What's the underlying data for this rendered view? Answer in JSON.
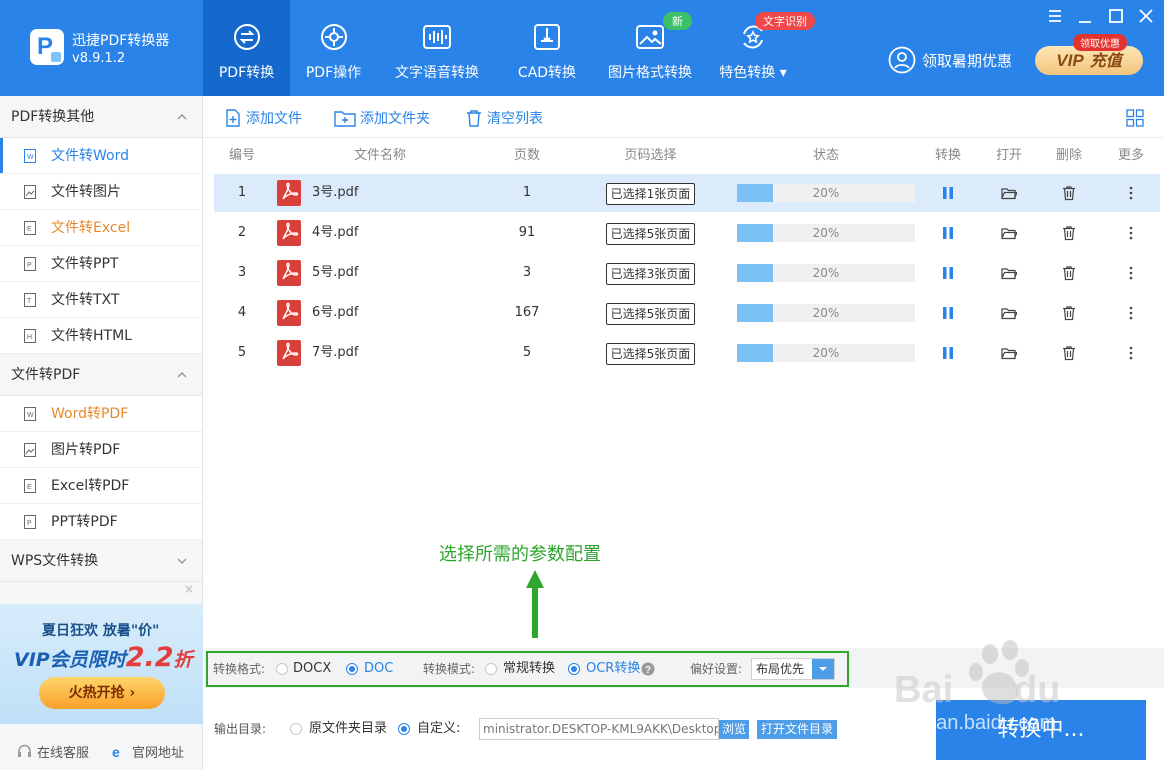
{
  "header": {
    "app_name": "迅捷PDF转换器",
    "version": "v8.9.1.2",
    "promo_text": "领取暑期优惠",
    "vip_tag": "领取优惠",
    "vip_label": "VIP",
    "vip_action": "充值",
    "nav": [
      {
        "label": "PDF转换",
        "icon": "pdf-convert-icon",
        "active": true
      },
      {
        "label": "PDF操作",
        "icon": "gear-icon"
      },
      {
        "label": "文字语音转换",
        "icon": "waveform-icon"
      },
      {
        "label": "CAD转换",
        "icon": "cad-icon"
      },
      {
        "label": "图片格式转换",
        "icon": "image-icon",
        "badge": "新"
      },
      {
        "label": "特色转换",
        "icon": "star-refresh-icon",
        "badge": "文字识别",
        "dropdown": true
      }
    ]
  },
  "sidebar": {
    "groups": [
      {
        "title": "PDF转换其他",
        "expanded": true,
        "items": [
          "文件转Word",
          "文件转图片",
          "文件转Excel",
          "文件转PPT",
          "文件转TXT",
          "文件转HTML"
        ]
      },
      {
        "title": "文件转PDF",
        "expanded": true,
        "items": [
          "Word转PDF",
          "图片转PDF",
          "Excel转PDF",
          "PPT转PDF"
        ]
      },
      {
        "title": "WPS文件转换",
        "expanded": false,
        "items": []
      }
    ],
    "banner": {
      "close": "×",
      "line1": "夏日狂欢 放暑\"价\"",
      "line2": "VIP会员限时",
      "price": "2.2",
      "unit": "折",
      "button": "火热开抢 ›"
    },
    "footer": {
      "service": "在线客服",
      "website": "官网地址"
    }
  },
  "toolbar": {
    "add_file": "添加文件",
    "add_folder": "添加文件夹",
    "clear_list": "清空列表"
  },
  "table": {
    "headers": [
      "编号",
      "文件名称",
      "页数",
      "页码选择",
      "状态",
      "转换",
      "打开",
      "删除",
      "更多"
    ],
    "rows": [
      {
        "no": "1",
        "name": "3号.pdf",
        "pages": "1",
        "selection": "已选择1张页面",
        "progress": 20,
        "status": "20%"
      },
      {
        "no": "2",
        "name": "4号.pdf",
        "pages": "91",
        "selection": "已选择5张页面",
        "progress": 20,
        "status": "20%"
      },
      {
        "no": "3",
        "name": "5号.pdf",
        "pages": "3",
        "selection": "已选择3张页面",
        "progress": 20,
        "status": "20%"
      },
      {
        "no": "4",
        "name": "6号.pdf",
        "pages": "167",
        "selection": "已选择5张页面",
        "progress": 20,
        "status": "20%"
      },
      {
        "no": "5",
        "name": "7号.pdf",
        "pages": "5",
        "selection": "已选择5张页面",
        "progress": 20,
        "status": "20%"
      }
    ]
  },
  "annotation": {
    "text": "选择所需的参数配置"
  },
  "settings": {
    "format_label": "转换格式:",
    "format_options": [
      "DOCX",
      "DOC"
    ],
    "format_selected": "DOC",
    "mode_label": "转换模式:",
    "mode_options": [
      "常规转换",
      "OCR转换"
    ],
    "mode_selected": "OCR转换",
    "pref_label": "偏好设置:",
    "pref_value": "布局优先"
  },
  "output": {
    "label": "输出目录:",
    "opt_original": "原文件夹目录",
    "opt_custom": "自定义:",
    "path": "ministrator.DESKTOP-KML9AKK\\Desktop",
    "browse": "浏览",
    "open_dir": "打开文件目录"
  },
  "convert_button": "转换中...",
  "watermark": "jingyan.baidu.com",
  "colors": {
    "brand": "#2a83e8",
    "highlight": "#2ea62e",
    "progress": "#7cc1f3",
    "orange": "#e6892d"
  }
}
